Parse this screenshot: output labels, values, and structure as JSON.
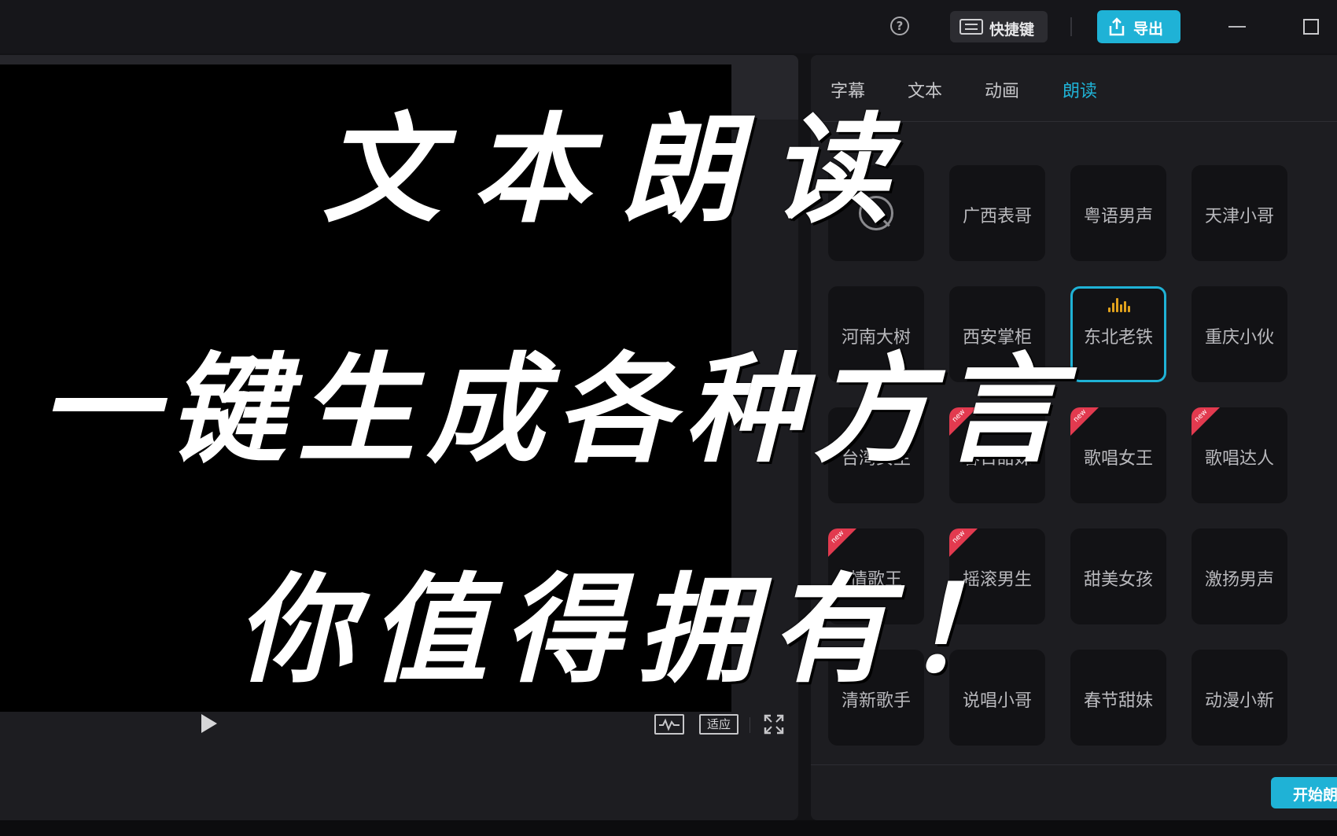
{
  "topbar": {
    "help_icon": "question-circle-icon",
    "shortcut_label": "快捷键",
    "export_label": "导出"
  },
  "player": {
    "fit_label": "适应"
  },
  "panel": {
    "tabs": [
      {
        "label": "字幕",
        "active": false
      },
      {
        "label": "文本",
        "active": false
      },
      {
        "label": "动画",
        "active": false
      },
      {
        "label": "朗读",
        "active": true
      }
    ],
    "voices": [
      {
        "label": "",
        "type": "none"
      },
      {
        "label": "广西表哥"
      },
      {
        "label": "粤语男声"
      },
      {
        "label": "天津小哥"
      },
      {
        "label": "河南大树"
      },
      {
        "label": "西安掌柜"
      },
      {
        "label": "东北老铁",
        "selected": true
      },
      {
        "label": "重庆小伙"
      },
      {
        "label": "台湾女生"
      },
      {
        "label": "春日甜妹",
        "new": true
      },
      {
        "label": "歌唱女王",
        "new": true
      },
      {
        "label": "歌唱达人",
        "new": true
      },
      {
        "label": "情歌王",
        "new": true
      },
      {
        "label": "摇滚男生",
        "new": true
      },
      {
        "label": "甜美女孩"
      },
      {
        "label": "激扬男声"
      },
      {
        "label": "清新歌手"
      },
      {
        "label": "说唱小哥"
      },
      {
        "label": "春节甜妹"
      },
      {
        "label": "动漫小新"
      }
    ],
    "new_tag": "new",
    "start_label": "开始朗读"
  },
  "overlay": {
    "line1": "文本朗读",
    "line2": "一键生成各种方言",
    "line3": "你值得拥有！"
  },
  "colors": {
    "accent": "#1fb2d6",
    "new_tag": "#e23a4f",
    "wave": "#e0a11d"
  }
}
